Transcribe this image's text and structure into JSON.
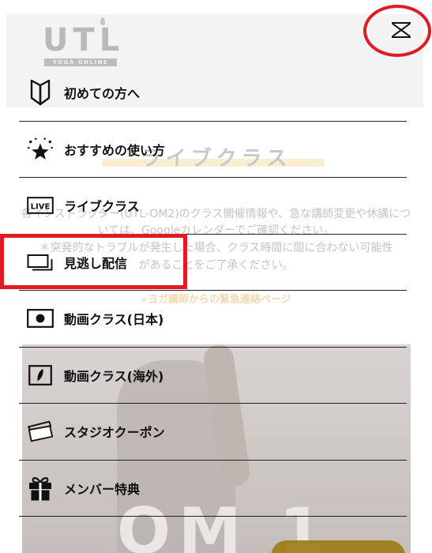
{
  "background": {
    "logo": {
      "main": "UTL",
      "sub": "YOGA ONLINE"
    },
    "section_title": "ライブクラス",
    "notice_lines": [
      "各インストラクター(UTL-OM2)のクラス開催情報や、急な講師変更や休講につ",
      "いては、Googleカレンダーでご確認ください。",
      "＊突発的なトラブルが発生した場合、クラス時間に間に合わない可能性",
      "があることをご了承ください。"
    ],
    "link": "»ヨガ講師からの緊急連絡ページ",
    "hero_text": "OM 1"
  },
  "menu": {
    "close_icon": "close-icon",
    "items": [
      {
        "label": "初めての方へ",
        "icon": "beginner-mark-icon"
      },
      {
        "label": "おすすめの使い方",
        "icon": "star-sparkle-icon"
      },
      {
        "label": "ライブクラス",
        "icon": "live-badge-icon"
      },
      {
        "label": "見逃し配信",
        "icon": "replay-screens-icon"
      },
      {
        "label": "動画クラス(日本)",
        "icon": "japan-flag-icon"
      },
      {
        "label": "動画クラス(海外)",
        "icon": "overseas-video-icon"
      },
      {
        "label": "スタジオクーポン",
        "icon": "coupon-ticket-icon"
      },
      {
        "label": "メンバー特典",
        "icon": "gift-box-icon"
      }
    ]
  },
  "annotations": {
    "color": "#e01b24",
    "marks": [
      "close-button",
      "menu-item-replay"
    ]
  }
}
